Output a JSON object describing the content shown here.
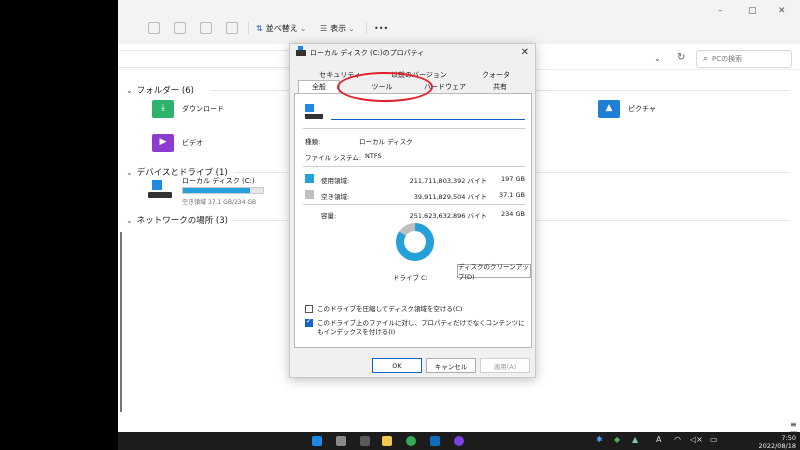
{
  "toolbar": {
    "sort_label": "並べ替え",
    "view_label": "表示",
    "more_label": "•••",
    "win_min": "–",
    "win_max": "▢",
    "win_close": "✕"
  },
  "address": {
    "search_placeholder": "PCの検索",
    "chev": "⌄",
    "refresh": "↻"
  },
  "sections": {
    "folders": "フォルダー (6)",
    "drives": "デバイスとドライブ (1)",
    "network": "ネットワークの場所 (3)"
  },
  "folders": [
    {
      "name": "ダウンロード",
      "icon": "download-folder-icon"
    },
    {
      "name": "ビデオ",
      "icon": "video-folder-icon"
    },
    {
      "name": "ピクチャ",
      "icon": "pictures-folder-icon"
    }
  ],
  "drive": {
    "name": "ローカル ディスク (C:)",
    "free_text": "空き領域 37.1 GB/234 GB",
    "used_fraction": 0.84
  },
  "dialog": {
    "title": "ローカル ディスク (C:)のプロパティ",
    "close": "✕",
    "tabs_top": [
      "セキュリティ",
      "以前のバージョン",
      "クォータ"
    ],
    "tabs_bottom": [
      "全般",
      "ツール",
      "ハードウェア",
      "共有"
    ],
    "type_label": "種類:",
    "type_value": "ローカル ディスク",
    "fs_label": "ファイル システム:",
    "fs_value": "NTFS",
    "used_label": "使用領域:",
    "used_bytes": "211,711,803,392 バイト",
    "used_gb": "197 GB",
    "free_label": "空き領域:",
    "free_bytes": "39,911,829,504 バイト",
    "free_gb": "37.1 GB",
    "capacity_label": "容量:",
    "capacity_bytes": "251,623,632,896 バイト",
    "capacity_gb": "234 GB",
    "drive_label": "ドライブ C:",
    "cleanup_button": "ディスクのクリーンアップ(D)",
    "compress_label": "このドライブを圧縮してディスク領域を空ける(C)",
    "index_label": "このドライブ上のファイルに対し、プロパティだけでなくコンテンツにもインデックスを付ける(I)",
    "ok": "OK",
    "cancel": "キャンセル",
    "apply": "適用(A)",
    "used_color": "#26a0da",
    "free_color": "#bfbfbf"
  },
  "taskbar": {
    "time": "7:50",
    "date": "2022/08/18",
    "lang": "A"
  }
}
